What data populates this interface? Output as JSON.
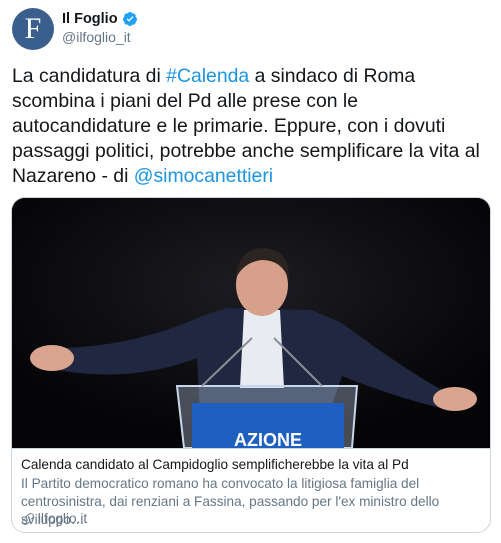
{
  "account": {
    "avatar_letter": "F",
    "display_name": "Il Foglio",
    "handle": "@ilfoglio_it",
    "verified": true,
    "brand_color": "#3b5f8c"
  },
  "tweet": {
    "text_parts": {
      "p1": "La candidatura di ",
      "hashtag": "#Calenda",
      "p2": " a sindaco di Roma scombina i piani del Pd alle prese con le autocandidature e le primarie. Eppure, con i dovuti passaggi politici, potrebbe anche semplificare la vita al Nazareno - di ",
      "mention": "@simocanettieri"
    },
    "link_color": "#1b95e0"
  },
  "card": {
    "image_alt": "Man in suit with arms spread at a podium",
    "podium_text": "AZIONE",
    "title": "Calenda candidato al Campidoglio semplificherebbe la vita al Pd",
    "description": "Il Partito democratico romano ha convocato la litigiosa famiglia del centrosinistra, dai renziani a Fassina, passando per l'ex ministro dello sviluppo…",
    "domain": "ilfoglio.it",
    "domain_icon": "link-icon"
  }
}
